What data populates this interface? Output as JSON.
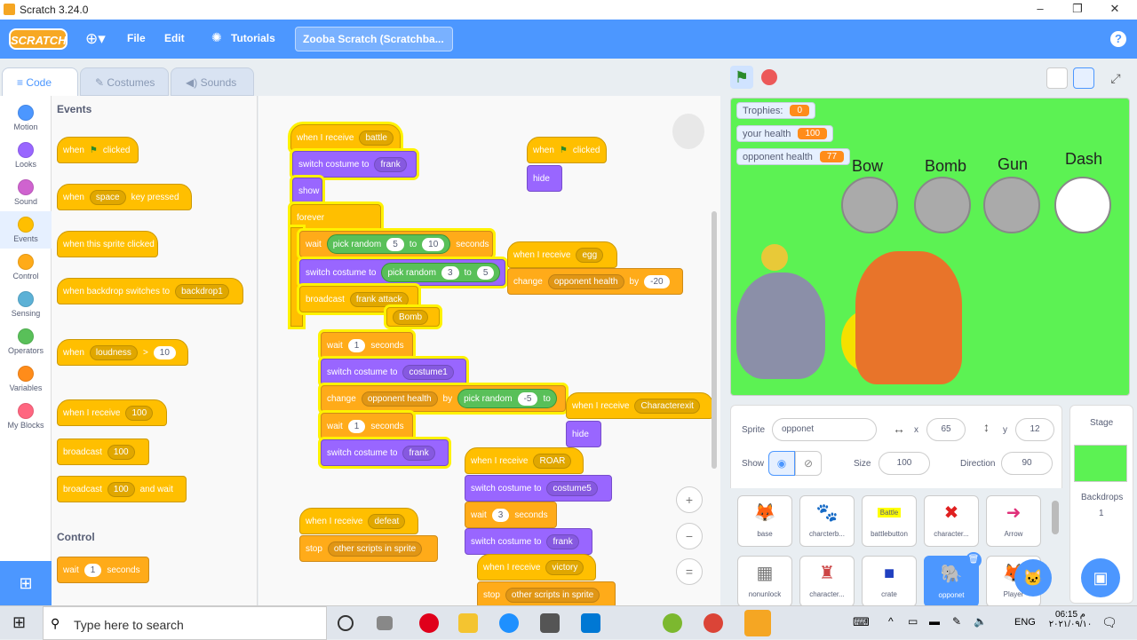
{
  "window": {
    "title": "Scratch 3.24.0",
    "min": "–",
    "max": "❐",
    "close": "✕"
  },
  "menu": {
    "logo": "SCRATCH",
    "file": "File",
    "edit": "Edit",
    "tutorials": "Tutorials",
    "project_title": "Zooba Scratch (Scratchba...",
    "help": "?"
  },
  "tabs": {
    "code": "Code",
    "costumes": "Costumes",
    "sounds": "Sounds"
  },
  "categories": [
    {
      "label": "Motion",
      "color": "#4c97ff"
    },
    {
      "label": "Looks",
      "color": "#9966ff"
    },
    {
      "label": "Sound",
      "color": "#cf63cf"
    },
    {
      "label": "Events",
      "color": "#ffbf00"
    },
    {
      "label": "Control",
      "color": "#ffab19"
    },
    {
      "label": "Sensing",
      "color": "#5cb1d6"
    },
    {
      "label": "Operators",
      "color": "#59c059"
    },
    {
      "label": "Variables",
      "color": "#ff8c1a"
    },
    {
      "label": "My Blocks",
      "color": "#ff6680"
    }
  ],
  "palette": {
    "events_title": "Events",
    "control_title": "Control",
    "when": "when",
    "clicked": "clicked",
    "space": "space",
    "key_pressed": "key pressed",
    "when_sprite_clicked": "when this sprite clicked",
    "when_backdrop": "when backdrop switches to",
    "backdrop1": "backdrop1",
    "loudness": "loudness",
    "gt": ">",
    "ten": "10",
    "when_receive": "when I receive",
    "hundred": "100",
    "broadcast": "broadcast",
    "and_wait": "and wait",
    "wait": "wait",
    "one": "1",
    "seconds": "seconds"
  },
  "scripts": {
    "when_receive": "when I receive",
    "battle": "battle",
    "switch_costume": "switch costume to",
    "frank": "frank",
    "show": "show",
    "forever": "forever",
    "wait": "wait",
    "pick_random": "pick random",
    "five": "5",
    "to": "to",
    "ten": "10",
    "seconds": "seconds",
    "three": "3",
    "broadcast": "broadcast",
    "frank_attack": "frank attack",
    "bomb": "Bomb",
    "one": "1",
    "costume1": "costume1",
    "change": "change",
    "opponent_health": "opponent health",
    "by": "by",
    "neg5": "-5",
    "when": "when",
    "clicked": "clicked",
    "hide": "hide",
    "egg": "egg",
    "neg20": "-20",
    "characterexit": "Characterexit",
    "roar": "ROAR",
    "costume5": "costume5",
    "defeat": "defeat",
    "stop": "stop",
    "other_scripts": "other scripts in sprite",
    "victory": "victory",
    "zoom_in": "+",
    "zoom_out": "−",
    "zoom_reset": "="
  },
  "stage": {
    "monitors": [
      {
        "label": "Trophies:",
        "value": "0"
      },
      {
        "label": "your health",
        "value": "100"
      },
      {
        "label": "opponent health",
        "value": "77"
      }
    ],
    "weapons": [
      "Bow",
      "Bomb",
      "Gun",
      "Dash"
    ]
  },
  "sprite_info": {
    "sprite_label": "Sprite",
    "sprite_name": "opponet",
    "x_label": "x",
    "x": "65",
    "y_label": "y",
    "y": "12",
    "show_label": "Show",
    "size_label": "Size",
    "size": "100",
    "direction_label": "Direction",
    "direction": "90"
  },
  "sprites": [
    "base",
    "charcterb...",
    "battlebutton",
    "character...",
    "Arrow",
    "nonunlock",
    "character...",
    "crate",
    "opponet",
    "Player"
  ],
  "stage_pane": {
    "title": "Stage",
    "backdrops_label": "Backdrops",
    "backdrops_count": "1"
  },
  "taskbar": {
    "search": "Type here to search",
    "lang": "ENG",
    "time": "06:15 م",
    "date": "٢٠٢١/٠٩/١٠"
  }
}
